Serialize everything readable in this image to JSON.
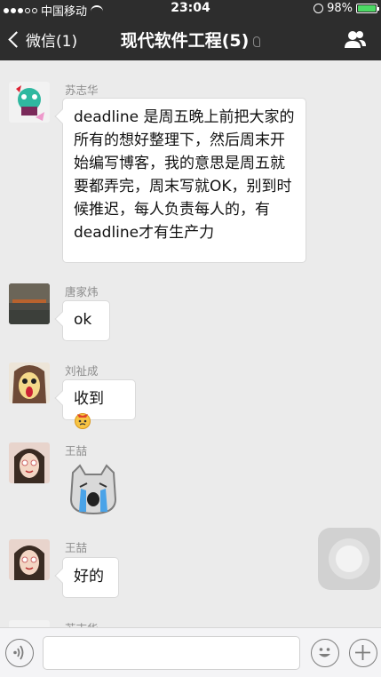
{
  "status_bar": {
    "carrier": "中国移动",
    "time": "23:04",
    "battery_percent": "98%",
    "battery_level": 0.98
  },
  "nav": {
    "back_label": "微信(1)",
    "title": "现代软件工程(5)"
  },
  "messages": [
    {
      "sender": "苏志华",
      "type": "text",
      "text": "deadline 是周五晚上前把大家的所有的想好整理下，然后周末开始编写博客，我的意思是周五就要都弄完，周末写就OK，别到时候推迟，每人负责每人的，有deadline才有生产力"
    },
    {
      "sender": "唐家炜",
      "type": "text",
      "text": "ok"
    },
    {
      "sender": "刘祉成",
      "type": "text",
      "text": "收到",
      "emoji": "angry-face-emoji"
    },
    {
      "sender": "王喆",
      "type": "sticker",
      "sticker": "crying-cat-sticker"
    },
    {
      "sender": "王喆",
      "type": "text",
      "text": "好的"
    },
    {
      "sender": "苏志华",
      "type": "partial"
    }
  ],
  "colors": {
    "bar_bg": "#2d2d2d",
    "chat_bg": "#ebebeb",
    "bubble_bg": "#ffffff",
    "battery_green": "#4cd964"
  },
  "icons": {
    "voice": "voice-mode-icon",
    "emoji": "emoji-icon",
    "plus": "plus-icon",
    "contacts": "group-members-icon",
    "ear": "earpiece-mode-icon"
  }
}
